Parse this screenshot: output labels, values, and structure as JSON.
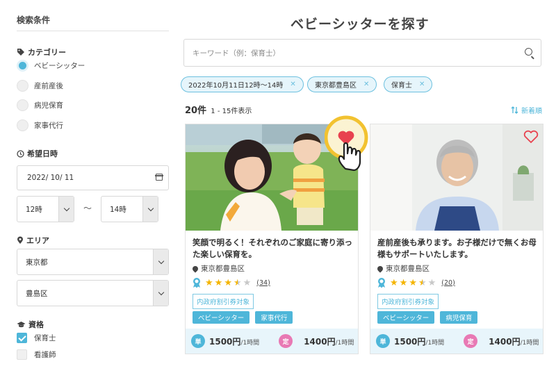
{
  "sidebar": {
    "title": "検索条件",
    "category": {
      "heading": "カテゴリー",
      "options": [
        "ベビーシッター",
        "産前産後",
        "病児保育",
        "家事代行"
      ],
      "selected_index": 0
    },
    "date": {
      "heading": "希望日時",
      "date_value": "2022/ 10/ 11",
      "start_time": "12時",
      "separator": "〜",
      "end_time": "14時"
    },
    "area": {
      "heading": "エリア",
      "prefecture": "東京都",
      "city": "豊島区"
    },
    "qualification": {
      "heading": "資格",
      "options": [
        {
          "label": "保育士",
          "checked": true
        },
        {
          "label": "看護師",
          "checked": false
        }
      ]
    }
  },
  "main": {
    "title": "ベビーシッターを探す",
    "search_placeholder": "キーワード（例：保育士）",
    "chips": [
      "2022年10月11日12時〜14時",
      "東京都豊島区",
      "保育士"
    ],
    "count_number": "20件",
    "count_range": "1 - 15件表示",
    "sort_label": "新着順"
  },
  "cards": [
    {
      "title": "笑顔で明るく！それぞれのご家庭に寄り添った楽しい保育を。",
      "location": "東京都豊島区",
      "rating": 3.5,
      "review_count": "(34)",
      "gov_label": "内政府割引券対象",
      "tags": [
        "ベビーシッター",
        "家事代行"
      ],
      "price_single_badge": "単",
      "price_single": "1500円",
      "price_single_unit": "/1時間",
      "price_regular_badge": "定",
      "price_regular": "1400円",
      "price_regular_unit": "/1時間",
      "favorited": true
    },
    {
      "title": "産前産後も承ります。お子様だけで無くお母様もサポートいたします。",
      "location": "東京都豊島区",
      "rating": 3.5,
      "review_count": "(20)",
      "gov_label": "内政府割引券対象",
      "tags": [
        "ベビーシッター",
        "病児保育"
      ],
      "price_single_badge": "単",
      "price_single": "1500円",
      "price_single_unit": "/1時間",
      "price_regular_badge": "定",
      "price_regular": "1400円",
      "price_regular_unit": "/1時間",
      "favorited": false
    }
  ],
  "colors": {
    "accent": "#4eb6d9",
    "heart_active": "#e8424f",
    "highlight_ring": "#f2c230",
    "single_badge": "#4eb6d9",
    "regular_badge": "#e879b4"
  }
}
